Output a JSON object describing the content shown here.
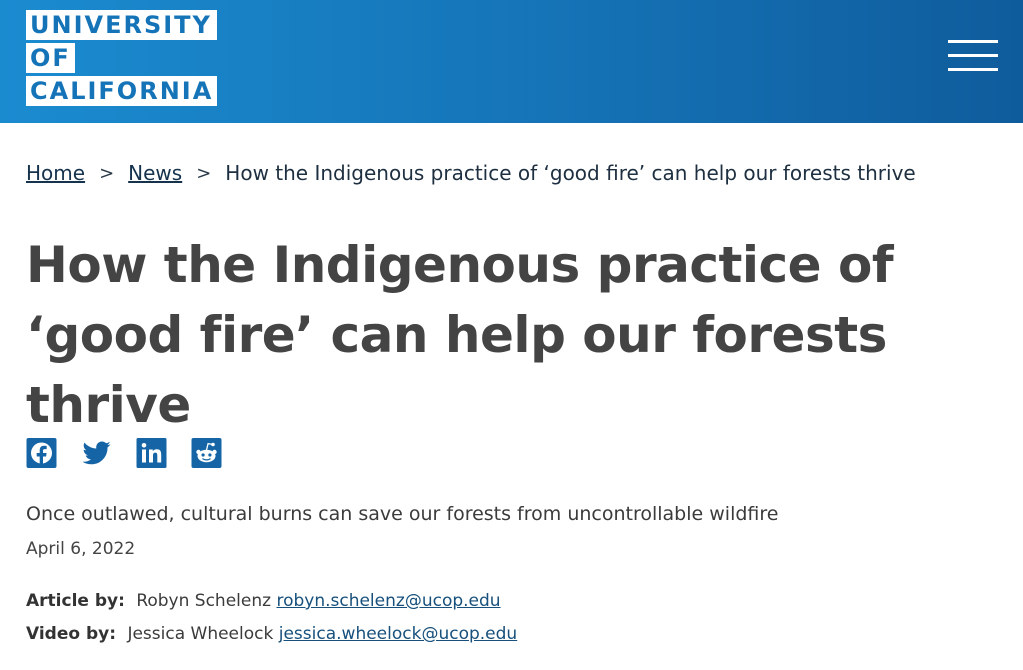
{
  "header": {
    "logo_lines": [
      "UNIVERSITY",
      "OF",
      "CALIFORNIA"
    ],
    "menu_icon": "hamburger-menu-icon",
    "colors": {
      "gradient_start": "#1b8bd0",
      "gradient_end": "#0f5c9c"
    }
  },
  "breadcrumb": {
    "items": [
      "Home",
      "News"
    ],
    "separator": ">",
    "current": "How the Indigenous practice of ‘good fire’ can help our forests thrive"
  },
  "article": {
    "title": "How the Indigenous practice of ‘good fire’ can help our forests thrive",
    "subtitle": "Once outlawed, cultural burns can save our forests from uncontrollable wildfire",
    "date": "April 6, 2022",
    "credits": [
      {
        "label": "Article by:",
        "name": "Robyn Schelenz",
        "email": "robyn.schelenz@ucop.edu"
      },
      {
        "label": "Video by:",
        "name": "Jessica Wheelock",
        "email": "jessica.wheelock@ucop.edu"
      }
    ]
  },
  "share": {
    "icons": [
      "facebook-icon",
      "twitter-icon",
      "linkedin-icon",
      "reddit-icon"
    ],
    "color": "#1565a6"
  }
}
